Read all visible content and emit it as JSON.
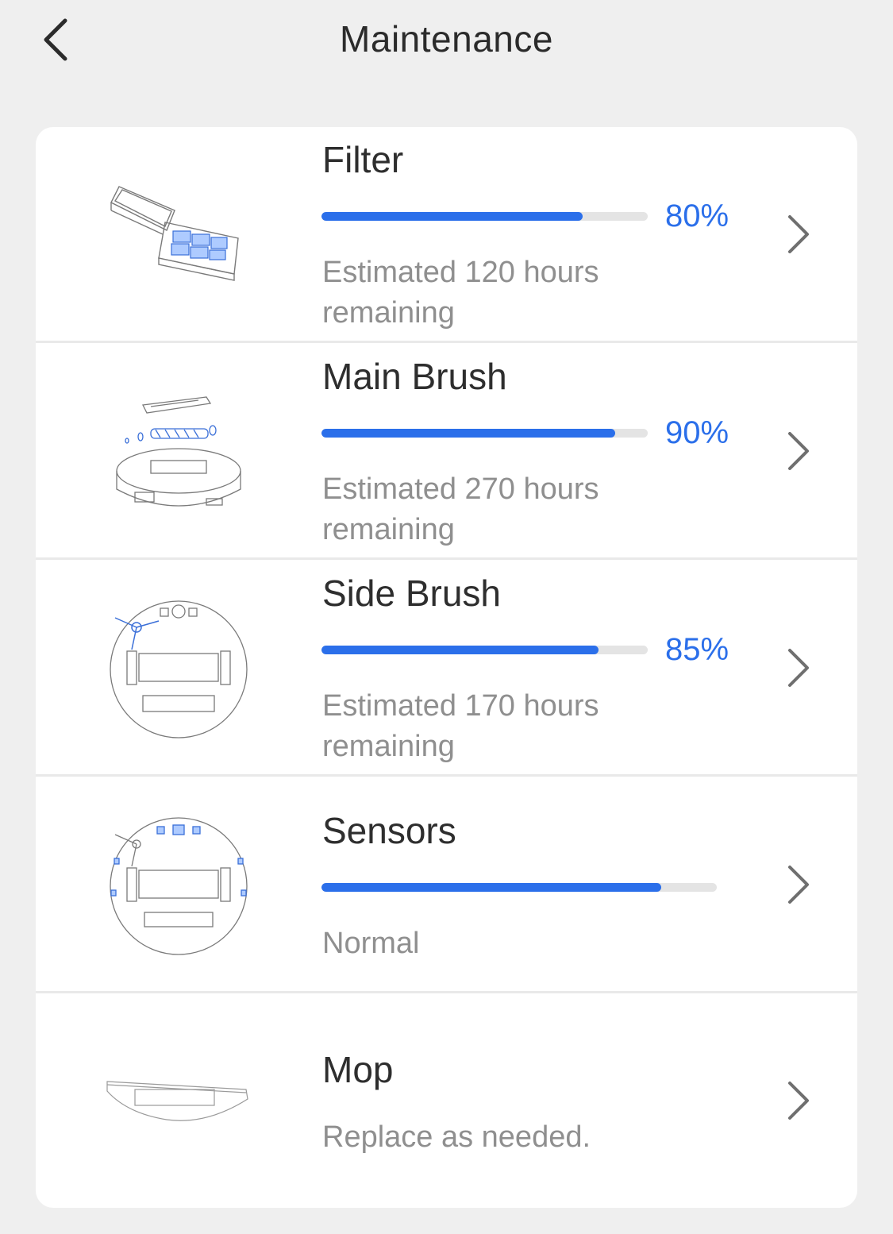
{
  "header": {
    "title": "Maintenance"
  },
  "items": [
    {
      "name": "Filter",
      "percent_label": "80%",
      "level": 0.8,
      "subtitle": "Estimated 120 hours remaining",
      "icon": "filter-icon"
    },
    {
      "name": "Main Brush",
      "percent_label": "90%",
      "level": 0.9,
      "subtitle": "Estimated 270 hours remaining",
      "icon": "main-brush-icon"
    },
    {
      "name": "Side Brush",
      "percent_label": "85%",
      "level": 0.85,
      "subtitle": "Estimated 170 hours remaining",
      "icon": "side-brush-icon"
    },
    {
      "name": "Sensors",
      "level": 0.86,
      "subtitle": "Normal",
      "icon": "sensors-icon"
    },
    {
      "name": "Mop",
      "subtitle": "Replace as needed.",
      "icon": "mop-icon"
    }
  ],
  "colors": {
    "accent": "#2b6fea",
    "background": "#efefef",
    "card": "#ffffff",
    "track": "#e4e4e4",
    "muted_text": "#8f8f8f"
  }
}
